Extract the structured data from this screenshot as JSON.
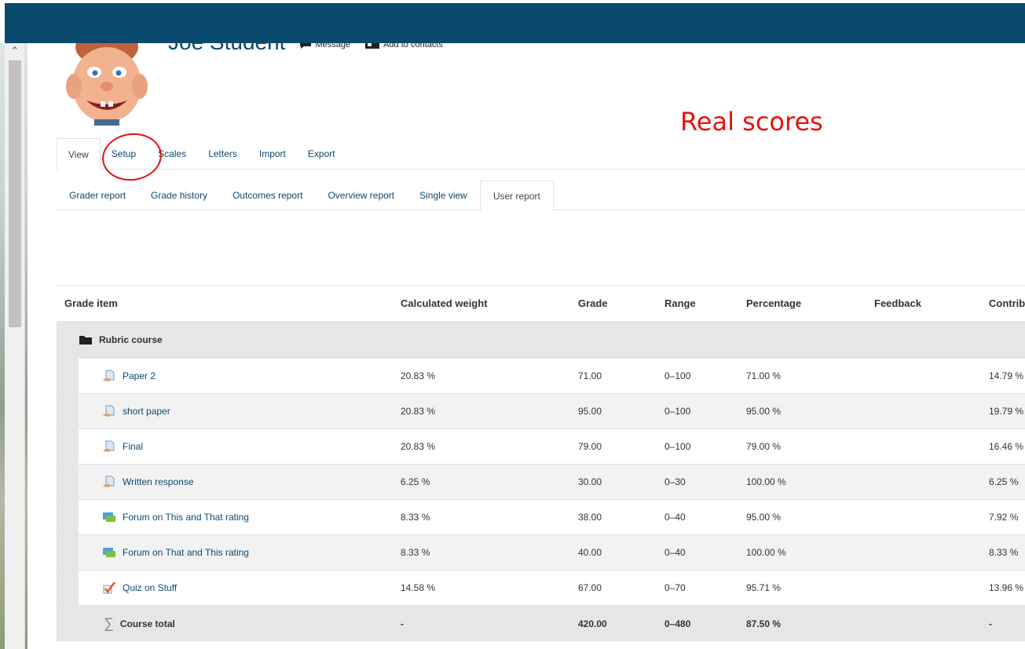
{
  "header": {
    "user_name": "Joe Student",
    "message_label": "Message",
    "contacts_label": "Add to contacts",
    "annotation": "Real scores"
  },
  "colors": {
    "topbar": "#0b4a6f",
    "link": "#0b4a6f",
    "annotation": "#e8110f"
  },
  "tabs_primary": [
    {
      "label": "View",
      "active": true
    },
    {
      "label": "Setup",
      "active": false
    },
    {
      "label": "Scales",
      "active": false
    },
    {
      "label": "Letters",
      "active": false
    },
    {
      "label": "Import",
      "active": false
    },
    {
      "label": "Export",
      "active": false
    }
  ],
  "tabs_secondary": [
    {
      "label": "Grader report"
    },
    {
      "label": "Grade history"
    },
    {
      "label": "Outcomes report"
    },
    {
      "label": "Overview report"
    },
    {
      "label": "Single view"
    },
    {
      "label": "User report",
      "active": true
    }
  ],
  "table": {
    "headers": {
      "item": "Grade item",
      "weight": "Calculated weight",
      "grade": "Grade",
      "range": "Range",
      "percentage": "Percentage",
      "feedback": "Feedback",
      "contribution": "Contribution to course total"
    },
    "category": "Rubric course",
    "rows": [
      {
        "icon": "assignment-icon",
        "name": "Paper 2",
        "weight": "20.83 %",
        "grade": "71.00",
        "range": "0–100",
        "pct": "71.00 %",
        "feedback": "",
        "contrib": "14.79 %"
      },
      {
        "icon": "assignment-icon",
        "name": "short paper",
        "weight": "20.83 %",
        "grade": "95.00",
        "range": "0–100",
        "pct": "95.00 %",
        "feedback": "",
        "contrib": "19.79 %"
      },
      {
        "icon": "assignment-icon",
        "name": "Final",
        "weight": "20.83 %",
        "grade": "79.00",
        "range": "0–100",
        "pct": "79.00 %",
        "feedback": "",
        "contrib": "16.46 %"
      },
      {
        "icon": "assignment-icon",
        "name": "Written response",
        "weight": "6.25 %",
        "grade": "30.00",
        "range": "0–30",
        "pct": "100.00 %",
        "feedback": "",
        "contrib": "6.25 %"
      },
      {
        "icon": "forum-icon",
        "name": "Forum on This and That rating",
        "weight": "8.33 %",
        "grade": "38.00",
        "range": "0–40",
        "pct": "95.00 %",
        "feedback": "",
        "contrib": "7.92 %"
      },
      {
        "icon": "forum-icon",
        "name": "Forum on That and This rating",
        "weight": "8.33 %",
        "grade": "40.00",
        "range": "0–40",
        "pct": "100.00 %",
        "feedback": "",
        "contrib": "8.33 %"
      },
      {
        "icon": "quiz-icon",
        "name": "Quiz on Stuff",
        "weight": "14.58 %",
        "grade": "67.00",
        "range": "0–70",
        "pct": "95.71 %",
        "feedback": "",
        "contrib": "13.96 %"
      }
    ],
    "total": {
      "label": "Course total",
      "weight": "-",
      "grade": "420.00",
      "range": "0–480",
      "pct": "87.50 %",
      "feedback": "",
      "contrib": "-"
    }
  }
}
